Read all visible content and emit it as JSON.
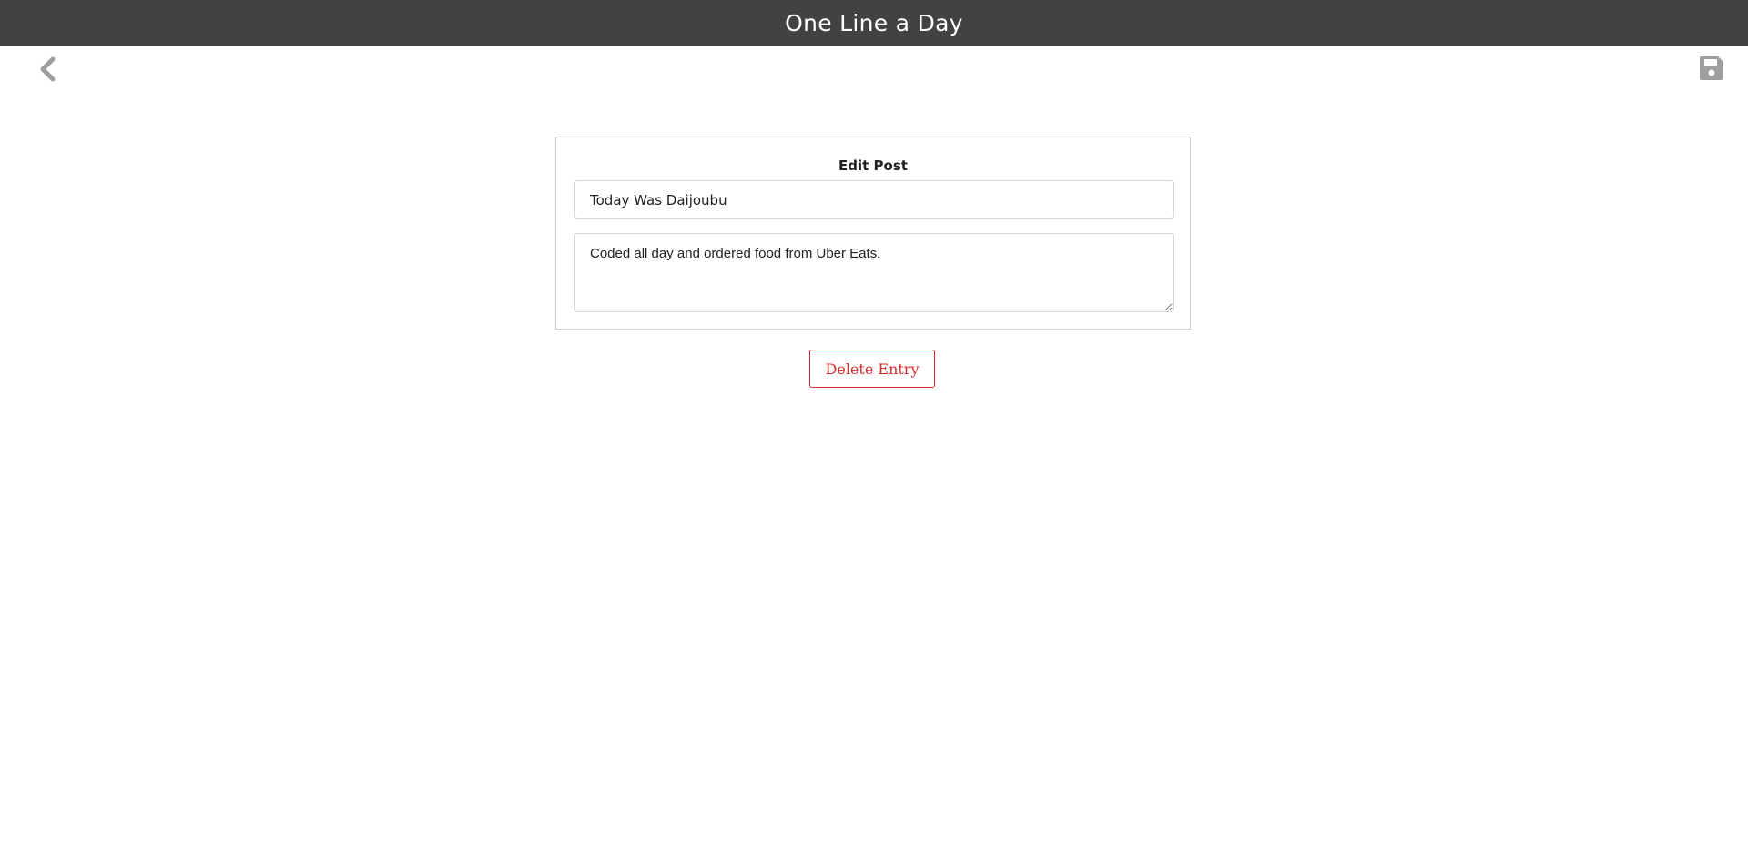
{
  "app": {
    "title": "One Line a Day"
  },
  "toolbar": {
    "back_icon": "chevron-left-icon",
    "save_icon": "floppy-disk-icon"
  },
  "edit_form": {
    "heading": "Edit Post",
    "title_value": "Today Was Daijoubu",
    "body_value": "Coded all day and ordered food from Uber Eats.",
    "delete_label": "Delete Entry"
  },
  "colors": {
    "topbar_bg": "#424242",
    "icon_gray": "#9e9e9e",
    "danger_red": "#d32f2f"
  }
}
